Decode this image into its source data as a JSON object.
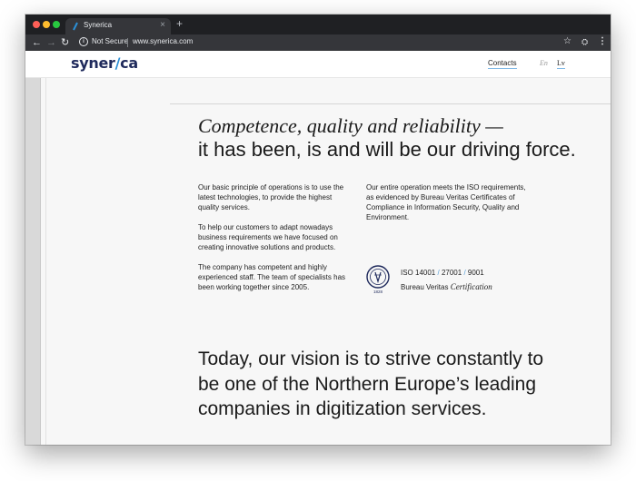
{
  "browser": {
    "tab_title": "Synerica",
    "tab_close": "×",
    "new_tab": "+",
    "security_label": "Not Secure",
    "url": "www.synerica.com",
    "icons": [
      "back-arrow-icon",
      "forward-arrow-icon",
      "reload-icon",
      "info-icon",
      "star-icon",
      "extension-icon",
      "menu-icon"
    ]
  },
  "header": {
    "logo": {
      "part1": "syner",
      "slash": "/",
      "part2": "ca"
    },
    "nav_contacts": "Contacts",
    "lang_en": "En",
    "lang_lv": "Lv"
  },
  "hero": {
    "line_italic": "Competence, quality and reliability —",
    "line_plain": "it has been, is and will be our driving force."
  },
  "left_column": {
    "p1": "Our basic principle of operations is to use the latest technologies, to provide the highest quality services.",
    "p2": "To help our customers to adapt nowadays business requirements we have focused on creating innovative solutions and products.",
    "p3": "The company has competent and highly experienced staff. The team of specialists has been working together since 2005."
  },
  "right_column": {
    "p1": "Our entire operation meets the ISO requirements, as evidenced by Bureau Veritas Certificates of Compliance in Information Security, Quality and Environment."
  },
  "certification": {
    "iso_1": "ISO 14001",
    "iso_2": "27001",
    "iso_3": "9001",
    "separator": "/",
    "issuer": "Bureau Veritas",
    "issuer_suffix": "Certification",
    "seal_year": "1828"
  },
  "vision": {
    "text": "Today, our vision is to strive constantly to be one of the Northern Europe’s leading companies in digitization services."
  },
  "colors": {
    "brand_navy": "#1f2a5c",
    "brand_blue": "#2b8fd6",
    "accent_underline": "#7fb8e6"
  }
}
